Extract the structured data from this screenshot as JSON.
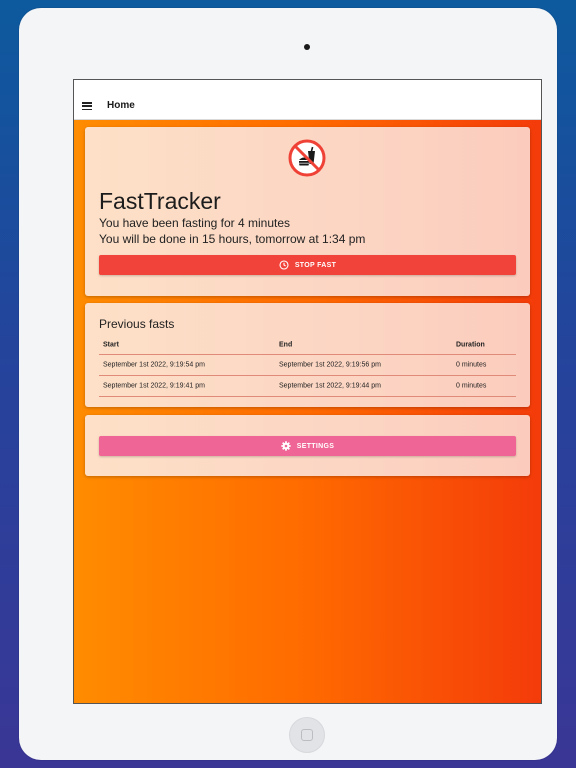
{
  "appbar": {
    "title": "Home"
  },
  "status_card": {
    "app_name": "FastTracker",
    "line1": "You have been fasting for 4 minutes",
    "line2": "You will be done in 15 hours, tomorrow at 1:34 pm",
    "stop_label": "STOP FAST"
  },
  "previous": {
    "title": "Previous fasts",
    "columns": [
      "Start",
      "End",
      "Duration"
    ],
    "rows": [
      [
        "September 1st 2022, 9:19:54 pm",
        "September 1st 2022, 9:19:56 pm",
        "0 minutes"
      ],
      [
        "September 1st 2022, 9:19:41 pm",
        "September 1st 2022, 9:19:44 pm",
        "0 minutes"
      ]
    ]
  },
  "settings": {
    "label": "SETTINGS"
  },
  "colors": {
    "accent_stop": "#f1433a",
    "accent_settings": "#ef6595",
    "gradient_start": "#ff8c00",
    "gradient_end": "#f43b0a"
  },
  "icons": [
    "menu-icon",
    "no-food-icon",
    "clock-icon",
    "gear-icon"
  ]
}
